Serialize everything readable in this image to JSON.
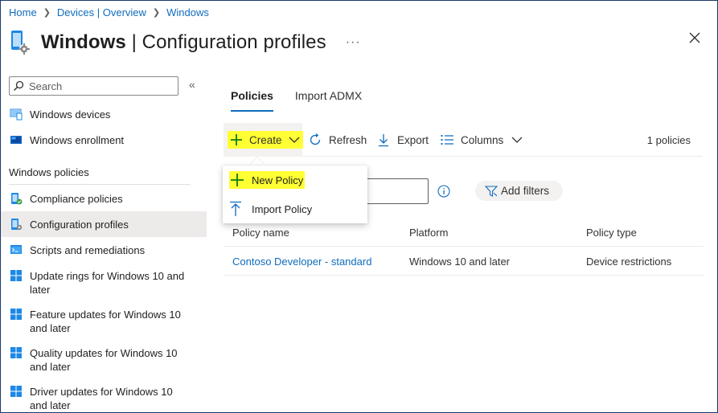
{
  "breadcrumb": [
    "Home",
    "Devices | Overview",
    "Windows"
  ],
  "header": {
    "title_strong": "Windows",
    "title_rest": " | Configuration profiles",
    "more": "···"
  },
  "sidebar": {
    "search_placeholder": "Search",
    "collapse": "«",
    "items_top": [
      {
        "label": "Windows devices",
        "icon": "devices-icon"
      },
      {
        "label": "Windows enrollment",
        "icon": "enrollment-icon"
      }
    ],
    "section_title": "Windows policies",
    "items": [
      {
        "label": "Compliance policies",
        "icon": "compliance-icon"
      },
      {
        "label": "Configuration profiles",
        "icon": "configuration-icon"
      },
      {
        "label": "Scripts and remediations",
        "icon": "scripts-icon"
      },
      {
        "label": "Update rings for Windows 10 and later",
        "icon": "windows-icon"
      },
      {
        "label": "Feature updates for Windows 10 and later",
        "icon": "windows-icon"
      },
      {
        "label": "Quality updates for Windows 10 and later",
        "icon": "windows-icon"
      },
      {
        "label": "Driver updates for Windows 10 and later",
        "icon": "windows-icon"
      }
    ]
  },
  "tabs": [
    {
      "label": "Policies",
      "active": true
    },
    {
      "label": "Import ADMX",
      "active": false
    }
  ],
  "toolbar": {
    "create": "Create",
    "refresh": "Refresh",
    "export": "Export",
    "columns": "Columns",
    "count": "1 policies"
  },
  "create_menu": {
    "new_policy": "New Policy",
    "import_policy": "Import Policy"
  },
  "filters": {
    "add_filters": "Add filters"
  },
  "table": {
    "headers": [
      "Policy name",
      "Platform",
      "Policy type"
    ],
    "rows": [
      {
        "name": "Contoso Developer - standard",
        "platform": "Windows 10 and later",
        "type": "Device restrictions"
      }
    ]
  },
  "colors": {
    "accent": "#0f6cbd",
    "highlight": "#ffff33",
    "selected_bg": "#edebe9"
  }
}
